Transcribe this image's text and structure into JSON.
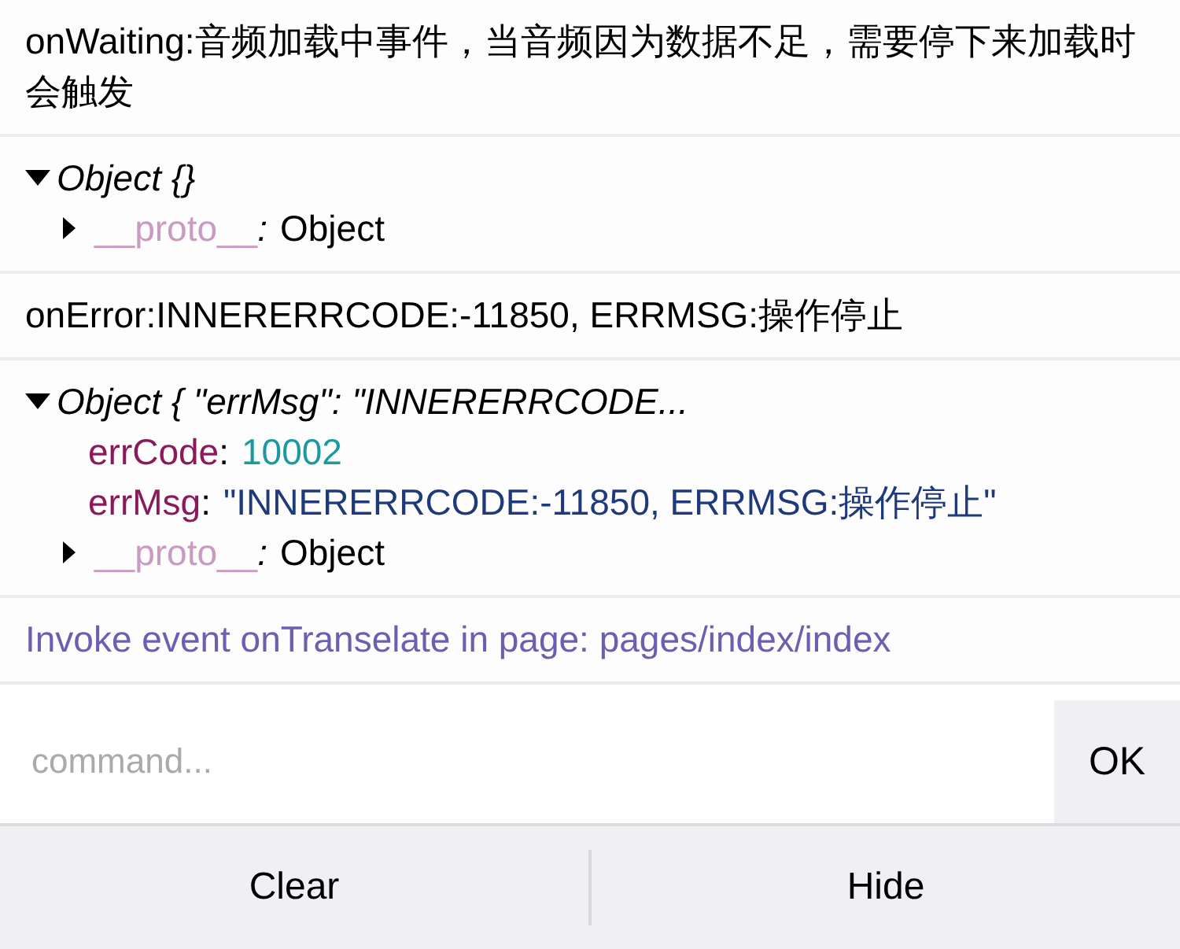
{
  "logs": [
    {
      "kind": "text",
      "text": "onWaiting:音频加载中事件，当音频因为数据不足，需要停下来加载时会触发"
    },
    {
      "kind": "object",
      "expanded": true,
      "summary": "Object {}",
      "properties": [
        {
          "kind": "proto",
          "key": "__proto__",
          "sep": ":",
          "value": "Object",
          "expanded": false
        }
      ]
    },
    {
      "kind": "text",
      "text": "onError:INNERERRCODE:-11850, ERRMSG:操作停止"
    },
    {
      "kind": "object",
      "expanded": true,
      "summary": "Object { \"errMsg\": \"INNERERRCODE...",
      "properties": [
        {
          "kind": "number",
          "key": "errCode",
          "sep": ":",
          "value": "10002"
        },
        {
          "kind": "string",
          "key": "errMsg",
          "sep": ":",
          "value": "\"INNERERRCODE:-11850, ERRMSG:操作停止\""
        },
        {
          "kind": "proto",
          "key": "__proto__",
          "sep": ":",
          "value": "Object",
          "expanded": false
        }
      ]
    },
    {
      "kind": "info",
      "text": "Invoke event onTranselate in page: pages/index/index"
    }
  ],
  "command": {
    "placeholder": "command...",
    "button": "OK"
  },
  "toolbar": [
    "Clear",
    "Hide"
  ]
}
